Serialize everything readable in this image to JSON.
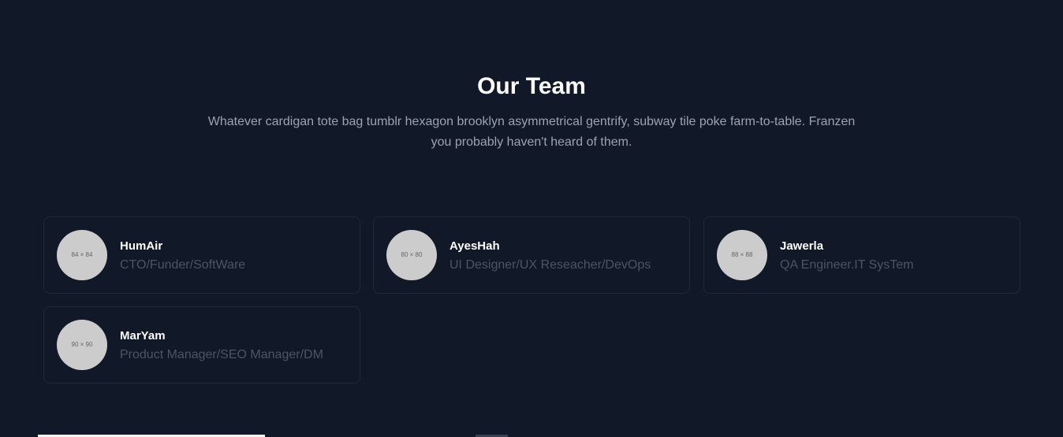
{
  "section": {
    "title": "Our Team",
    "description": "Whatever cardigan tote bag tumblr hexagon brooklyn asymmetrical gentrify, subway tile poke farm-to-table. Franzen you probably haven't heard of them."
  },
  "members": [
    {
      "avatar_text": "84 × 84",
      "name": "HumAir",
      "role": "CTO/Funder/SoftWare"
    },
    {
      "avatar_text": "80 × 80",
      "name": "AyesHah",
      "role": "UI Designer/UX Reseacher/DevOps"
    },
    {
      "avatar_text": "88 × 88",
      "name": "Jawerla",
      "role": "QA Engineer.IT SysTem"
    },
    {
      "avatar_text": "90 × 90",
      "name": "MarYam",
      "role": "Product Manager/SEO Manager/DM"
    }
  ],
  "colors": {
    "background": "#111827",
    "card_border": "#1f2937",
    "title": "#ffffff",
    "description": "#9ca3af",
    "role": "#4b5563",
    "avatar_placeholder": "#cccccc"
  }
}
